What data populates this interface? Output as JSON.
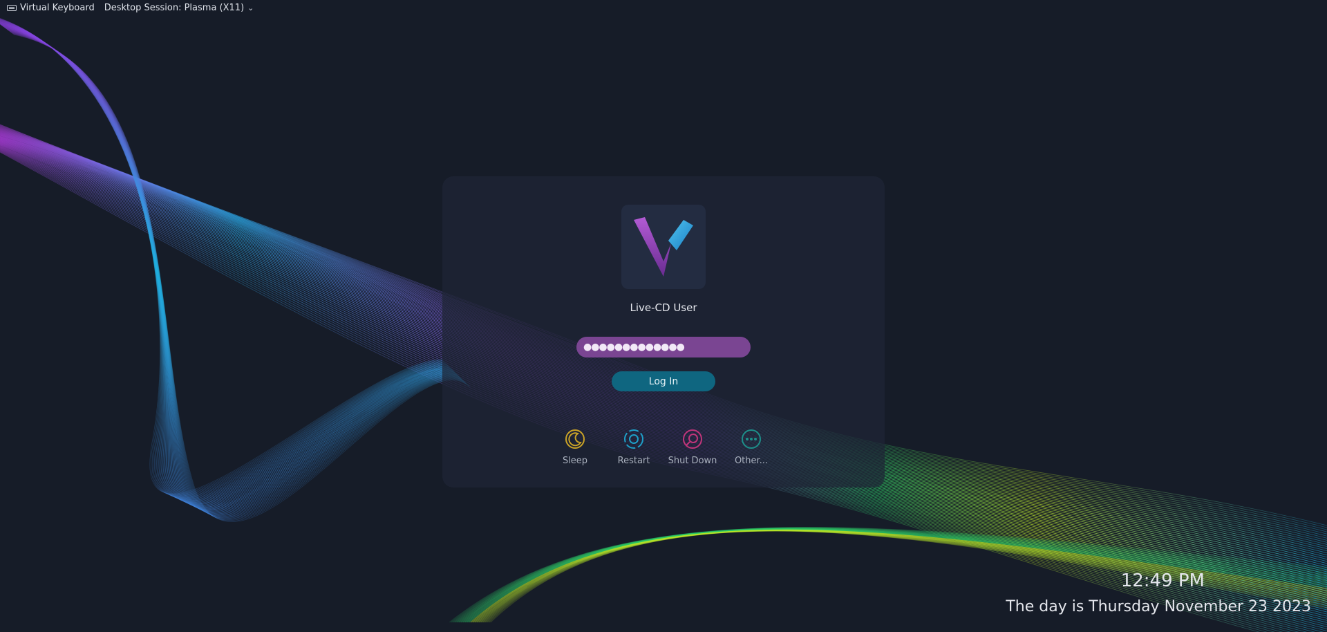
{
  "topbar": {
    "keyboard_label": "Virtual Keyboard",
    "keyboard_icon": "keyboard-icon",
    "session_label": "Desktop Session: Plasma (X11)",
    "session_icon": "chevron-down-icon"
  },
  "user": {
    "name": "Live-CD User",
    "avatar_icon": "v-logo-icon"
  },
  "password": {
    "masked_value": "●●●●●●●●●●●●●"
  },
  "login": {
    "label": "Log In"
  },
  "actions": [
    {
      "label": "Sleep",
      "icon": "sleep-icon",
      "color": "#c9a227"
    },
    {
      "label": "Restart",
      "icon": "restart-icon",
      "color": "#1e9fc8"
    },
    {
      "label": "Shut Down",
      "icon": "shutdown-icon",
      "color": "#c0357a"
    },
    {
      "label": "Other...",
      "icon": "more-icon",
      "color": "#1d8f8a"
    }
  ],
  "clock": {
    "time": "12:49 PM",
    "date": "The day is Thursday November 23 2023"
  },
  "colors": {
    "background": "#161c28",
    "password_field": "#7a4592",
    "login_button": "#0f6680"
  }
}
